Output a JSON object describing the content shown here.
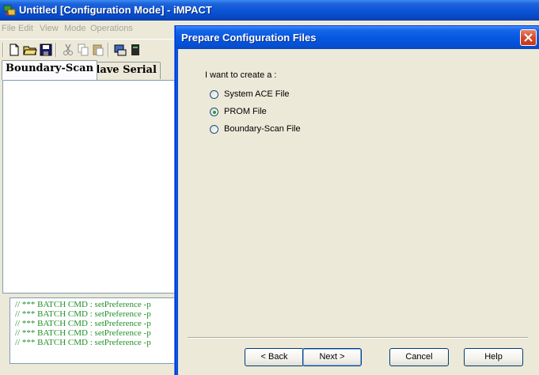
{
  "main_window": {
    "title": "Untitled [Configuration Mode]",
    "title_suffix": " - iMPACT",
    "icon": "impact-app-icon"
  },
  "menubar": {
    "items": [
      "File",
      "Edit",
      "View",
      "Mode",
      "Operations"
    ]
  },
  "toolbar": {
    "icons": [
      "new-file-icon",
      "open-folder-icon",
      "save-icon",
      "cut-icon",
      "copy-icon",
      "paste-icon",
      "device-icon",
      "program-icon"
    ]
  },
  "tabs": [
    "Boundary-Scan",
    "Slave Serial"
  ],
  "console": {
    "lines": [
      "// *** BATCH CMD : setPreference -p",
      "// *** BATCH CMD : setPreference -p",
      "// *** BATCH CMD : setPreference -p",
      "// *** BATCH CMD : setPreference -p",
      "// *** BATCH CMD : setPreference -p"
    ]
  },
  "dialog": {
    "title": "Prepare Configuration Files",
    "prompt": "I want to create a :",
    "options": [
      {
        "label": "System ACE File",
        "selected": false
      },
      {
        "label": "PROM File",
        "selected": true
      },
      {
        "label": "Boundary-Scan File",
        "selected": false
      }
    ],
    "buttons": {
      "back": "< Back",
      "next": "Next >",
      "cancel": "Cancel",
      "help": "Help"
    }
  },
  "colors": {
    "titlebar_blue": "#0a55d8",
    "console_text": "#22902a",
    "close_red": "#d44a2b",
    "radio_dot": "#21a121"
  }
}
